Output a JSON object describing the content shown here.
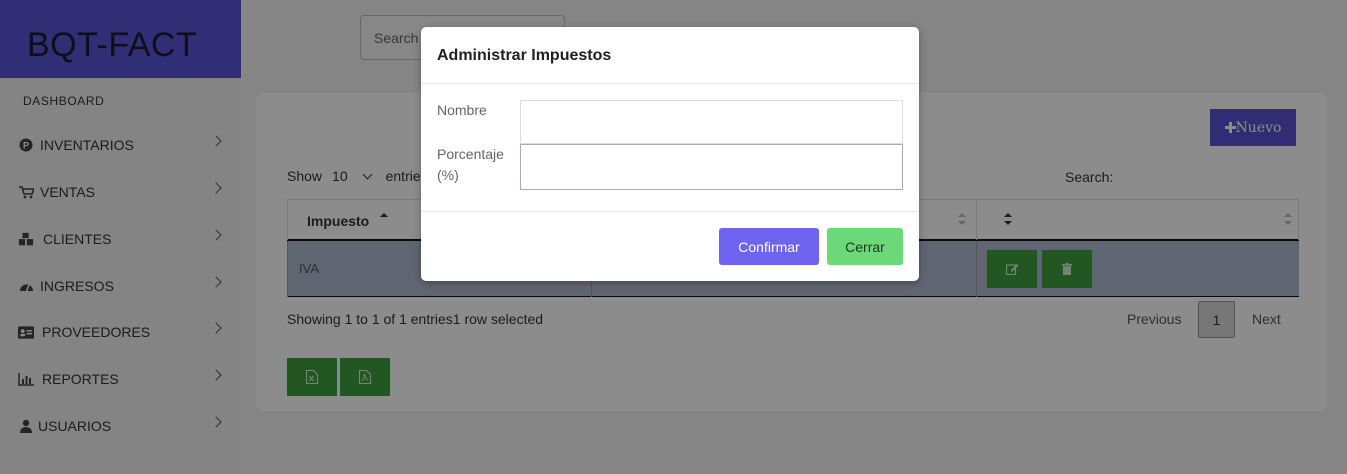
{
  "brand": "BQT-FACT",
  "sidebar": {
    "dashboard_label": "DASHBOARD",
    "items": [
      {
        "label": "INVENTARIOS",
        "icon": "parking-circle-icon"
      },
      {
        "label": "VENTAS",
        "icon": "cart-icon"
      },
      {
        "label": "CLIENTES",
        "icon": "cubes-icon"
      },
      {
        "label": "INGRESOS",
        "icon": "gauge-icon"
      },
      {
        "label": "PROVEEDORES",
        "icon": "id-card-icon"
      },
      {
        "label": "REPORTES",
        "icon": "bar-chart-icon"
      },
      {
        "label": "USUARIOS",
        "icon": "user-icon"
      }
    ]
  },
  "topbar": {
    "search_placeholder": "Search"
  },
  "content": {
    "new_button_label": "Nuevo",
    "show_prefix": "Show",
    "show_value": "10",
    "show_suffix": "entries",
    "search_label": "Search:",
    "columns": [
      "Impuesto",
      "",
      ""
    ],
    "rows": [
      {
        "impuesto": "IVA",
        "porcentaje": ""
      }
    ],
    "info_text": "Showing 1 to 1 of 1 entries1 row selected",
    "pagination": {
      "previous": "Previous",
      "page": "1",
      "next": "Next"
    }
  },
  "modal": {
    "title": "Administrar Impuestos",
    "nombre_label": "Nombre",
    "nombre_value": "",
    "porcentaje_label_1": "Porcentaje",
    "porcentaje_label_2": "(%)",
    "porcentaje_value": "",
    "confirm_label": "Confirmar",
    "close_label": "Cerrar"
  },
  "colors": {
    "brand": "#5b55d6",
    "primary": "#6f63f2",
    "success": "#6bd97a",
    "action_green": "#3e9e3e",
    "selected_row": "#b0b9cf"
  }
}
